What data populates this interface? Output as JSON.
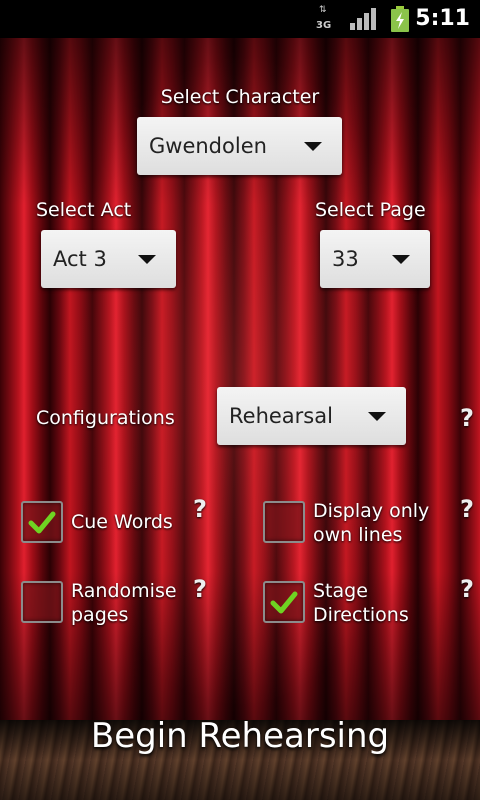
{
  "status_bar": {
    "network_label": "3G",
    "time": "5:11",
    "icons": [
      "network-3g-icon",
      "signal-icon",
      "battery-charging-icon"
    ]
  },
  "character": {
    "label": "Select Character",
    "value": "Gwendolen"
  },
  "act": {
    "label": "Select Act",
    "value": "Act 3"
  },
  "page": {
    "label": "Select Page",
    "value": "33"
  },
  "configurations": {
    "label": "Configurations",
    "value": "Rehearsal",
    "help": "?"
  },
  "options": {
    "cue_words": {
      "line1": "Cue Words",
      "line2": "",
      "checked": true,
      "help": "?"
    },
    "display_own_lines": {
      "line1": "Display only",
      "line2": "own lines",
      "checked": false,
      "help": "?"
    },
    "randomise_pages": {
      "line1": "Randomise",
      "line2": "pages",
      "checked": false,
      "help": "?"
    },
    "stage_directions": {
      "line1": "Stage",
      "line2": "Directions",
      "checked": true,
      "help": "?"
    }
  },
  "begin_button": "Begin Rehearsing",
  "colors": {
    "check": "#6fd322",
    "curtain": "#b3121d"
  }
}
